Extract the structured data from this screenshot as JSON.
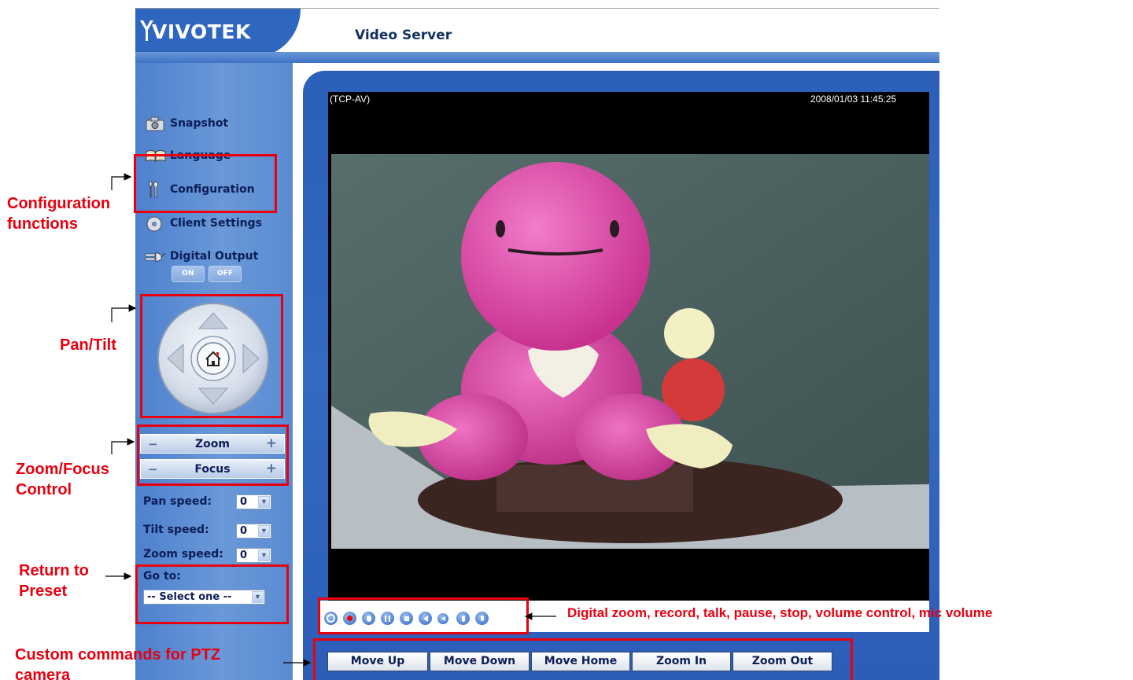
{
  "header": {
    "logo_text": "VIVOTEK",
    "title": "Video Server"
  },
  "sidebar": {
    "items": [
      {
        "label": "Snapshot",
        "icon": "camera-icon"
      },
      {
        "label": "Language",
        "icon": "language-icon"
      },
      {
        "label": "Configuration",
        "icon": "wrench-icon"
      },
      {
        "label": "Client Settings",
        "icon": "disc-icon"
      },
      {
        "label": "Digital Output",
        "icon": "plug-icon"
      }
    ],
    "digital_output": {
      "on_label": "ON",
      "off_label": "OFF"
    },
    "zoom_label": "Zoom",
    "focus_label": "Focus",
    "pan_speed": {
      "label": "Pan speed:",
      "value": "0"
    },
    "tilt_speed": {
      "label": "Tilt speed:",
      "value": "0"
    },
    "zoom_speed": {
      "label": "Zoom speed:",
      "value": "0"
    },
    "goto": {
      "label": "Go to:",
      "value": "-- Select one --"
    }
  },
  "video": {
    "protocol": "(TCP-AV)",
    "timestamp": "2008/01/03 11:45:25"
  },
  "control_bar": {
    "icons": [
      "digital-zoom-icon",
      "record-icon",
      "talk-icon",
      "pause-icon",
      "stop-icon",
      "volume-icon",
      "mute-icon",
      "mic-icon",
      "mic-volume-icon"
    ]
  },
  "ptz_buttons": [
    "Move Up",
    "Move Down",
    "Move Home",
    "Zoom In",
    "Zoom Out"
  ],
  "annotations": {
    "config": "Configuration functions",
    "pantilt": "Pan/Tilt",
    "zoomfocus": "Zoom/Focus Control",
    "preset": "Return to Preset",
    "custom": "Custom commands for PTZ camera",
    "toolbar": "Digital zoom, record, talk, pause, stop, volume control, mic volume"
  },
  "colors": {
    "annotation_red": "#e8000f",
    "sidebar_blue": "#6a98d8",
    "header_blue": "#2e66c0",
    "label_navy": "#0c1d57"
  }
}
